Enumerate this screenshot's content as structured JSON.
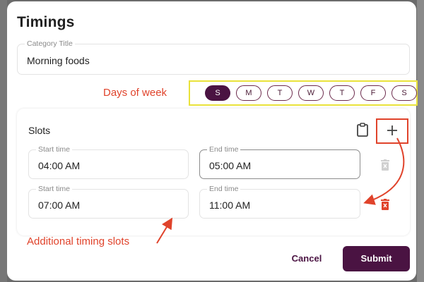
{
  "dialog": {
    "title": "Timings"
  },
  "category": {
    "label": "Category Title",
    "value": "Morning foods"
  },
  "annotations": {
    "days_label": "Days of week",
    "slots_label": "Additional timing slots",
    "color": "#e0432b",
    "highlight_color": "#e9e23a"
  },
  "days": [
    {
      "label": "S",
      "selected": true
    },
    {
      "label": "M",
      "selected": false
    },
    {
      "label": "T",
      "selected": false
    },
    {
      "label": "W",
      "selected": false
    },
    {
      "label": "T",
      "selected": false
    },
    {
      "label": "F",
      "selected": false
    },
    {
      "label": "S",
      "selected": false
    }
  ],
  "slots": {
    "title": "Slots",
    "rows": [
      {
        "start_label": "Start time",
        "start": "04:00 AM",
        "end_label": "End time",
        "end": "05:00 AM"
      },
      {
        "start_label": "Start time",
        "start": "07:00 AM",
        "end_label": "End time",
        "end": "11:00 AM"
      }
    ]
  },
  "icons": {
    "clipboard": "clipboard-icon",
    "add": "plus-icon",
    "delete": "trash-icon"
  },
  "footer": {
    "cancel_label": "Cancel",
    "submit_label": "Submit"
  },
  "colors": {
    "primary": "#4a1342",
    "delete_disabled": "#d0d0d0",
    "delete_active": "#e0432b"
  }
}
